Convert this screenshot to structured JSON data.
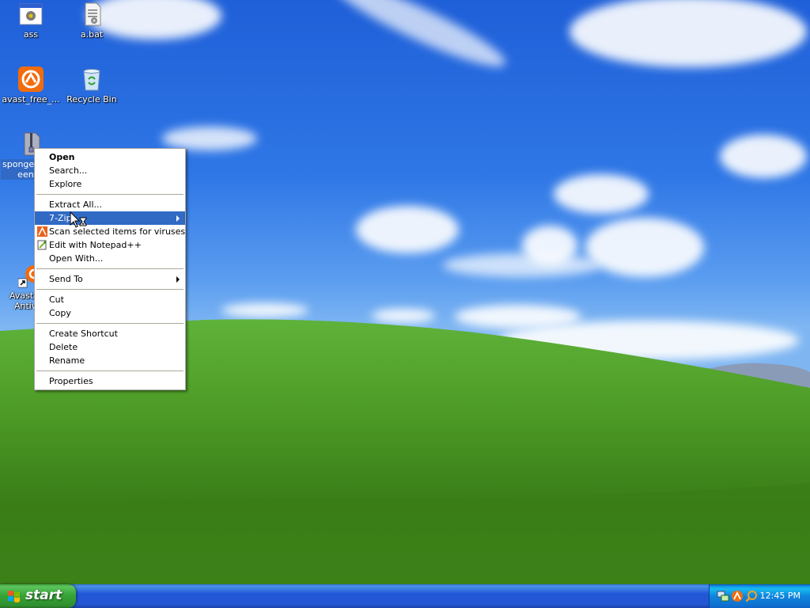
{
  "desktop": {
    "icons": [
      {
        "label": "ass",
        "icon": "application-window-icon"
      },
      {
        "label": "a.bat",
        "icon": "batch-file-icon"
      },
      {
        "label": "avast_free_...",
        "icon": "avast-installer-icon"
      },
      {
        "label": "Recycle Bin",
        "icon": "recycle-bin-icon"
      },
      {
        "label": "spongeb",
        "label_line2": "eent",
        "icon": "zip-file-icon",
        "selected": true
      },
      {
        "label": "Avast",
        "label_line2": "Antiv",
        "icon": "avast-shortcut-icon"
      }
    ]
  },
  "context_menu": {
    "groups": [
      [
        {
          "label": "Open",
          "default": true
        },
        {
          "label": "Search..."
        },
        {
          "label": "Explore"
        }
      ],
      [
        {
          "label": "Extract All..."
        },
        {
          "label": "7-Zip",
          "submenu": true,
          "highlighted": true
        },
        {
          "label": "Scan selected items for viruses",
          "icon": "avast-scan-icon"
        },
        {
          "label": "Edit with Notepad++",
          "icon": "notepad-plus-plus-icon"
        },
        {
          "label": "Open With..."
        }
      ],
      [
        {
          "label": "Send To",
          "submenu": true
        }
      ],
      [
        {
          "label": "Cut"
        },
        {
          "label": "Copy"
        }
      ],
      [
        {
          "label": "Create Shortcut"
        },
        {
          "label": "Delete"
        },
        {
          "label": "Rename"
        }
      ],
      [
        {
          "label": "Properties"
        }
      ]
    ]
  },
  "taskbar": {
    "start_label": "start",
    "clock": "12:45 PM",
    "tray_icons": [
      "network-icon",
      "avast-tray-icon",
      "search-tray-icon"
    ]
  },
  "colors": {
    "highlight": "#316ac5",
    "taskbar_blue": "#2456d2",
    "start_green": "#37a537"
  }
}
